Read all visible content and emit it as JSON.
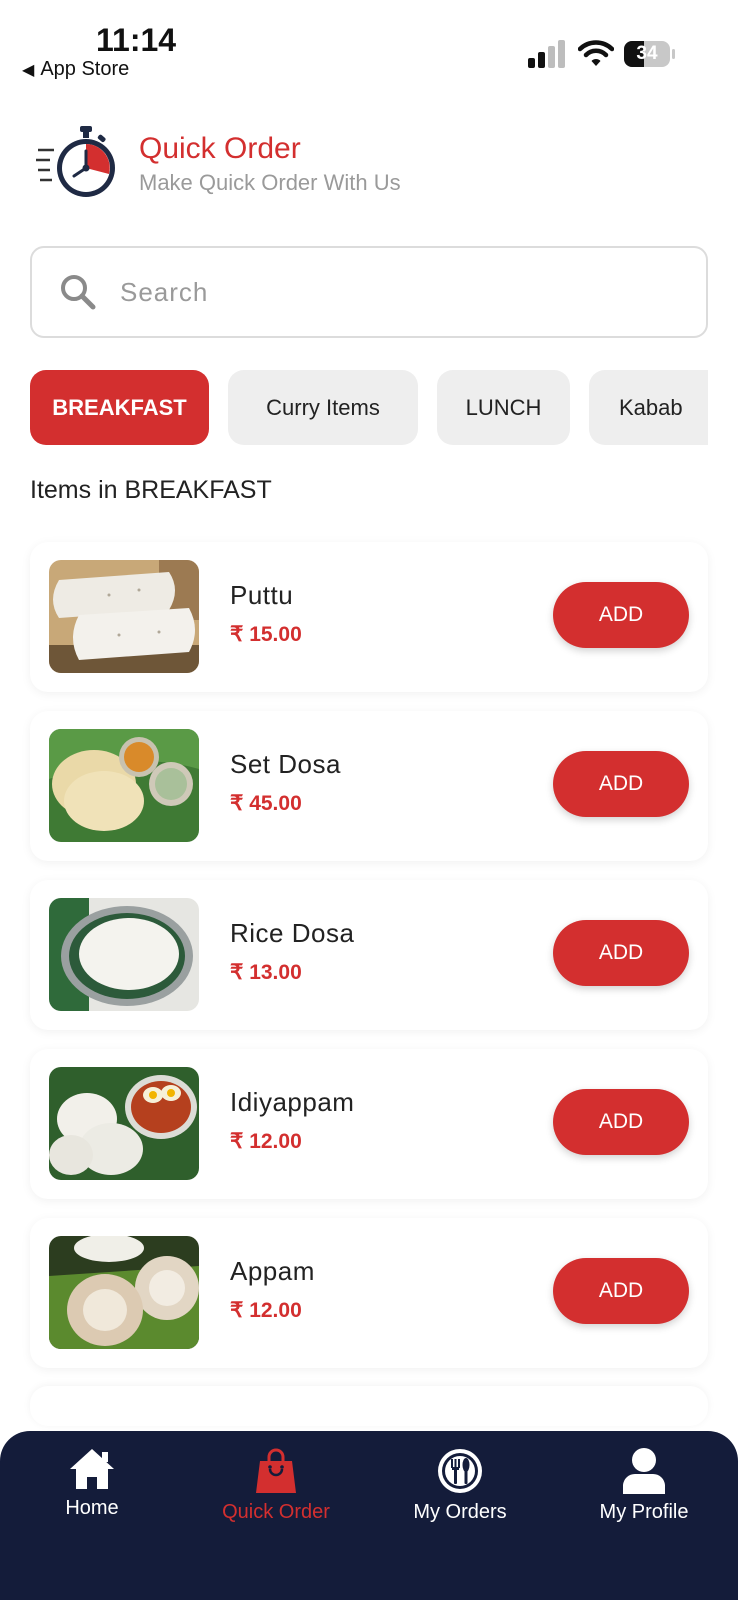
{
  "status_bar": {
    "time": "11:14",
    "back_label": "App Store",
    "battery": "34"
  },
  "header": {
    "title": "Quick Order",
    "subtitle": "Make Quick Order With Us"
  },
  "search": {
    "placeholder": "Search",
    "value": ""
  },
  "categories": [
    {
      "label": "BREAKFAST",
      "active": true
    },
    {
      "label": "Curry Items",
      "active": false
    },
    {
      "label": "LUNCH",
      "active": false
    },
    {
      "label": "Kabab",
      "active": false
    }
  ],
  "section_title": "Items in BREAKFAST",
  "items": [
    {
      "name": "Puttu",
      "price": "₹ 15.00",
      "add_label": "ADD"
    },
    {
      "name": "Set Dosa",
      "price": "₹ 45.00",
      "add_label": "ADD"
    },
    {
      "name": "Rice Dosa",
      "price": "₹ 13.00",
      "add_label": "ADD"
    },
    {
      "name": "Idiyappam",
      "price": "₹ 12.00",
      "add_label": "ADD"
    },
    {
      "name": "Appam",
      "price": "₹ 12.00",
      "add_label": "ADD"
    }
  ],
  "nav": [
    {
      "label": "Home",
      "icon": "home-icon",
      "active": false
    },
    {
      "label": "Quick Order",
      "icon": "shopping-bag-icon",
      "active": true
    },
    {
      "label": "My Orders",
      "icon": "plate-cutlery-icon",
      "active": false
    },
    {
      "label": "My Profile",
      "icon": "user-icon",
      "active": false
    }
  ],
  "colors": {
    "accent": "#d32f2f",
    "nav_background": "#141c3a",
    "chip_background": "#eeeeee"
  }
}
